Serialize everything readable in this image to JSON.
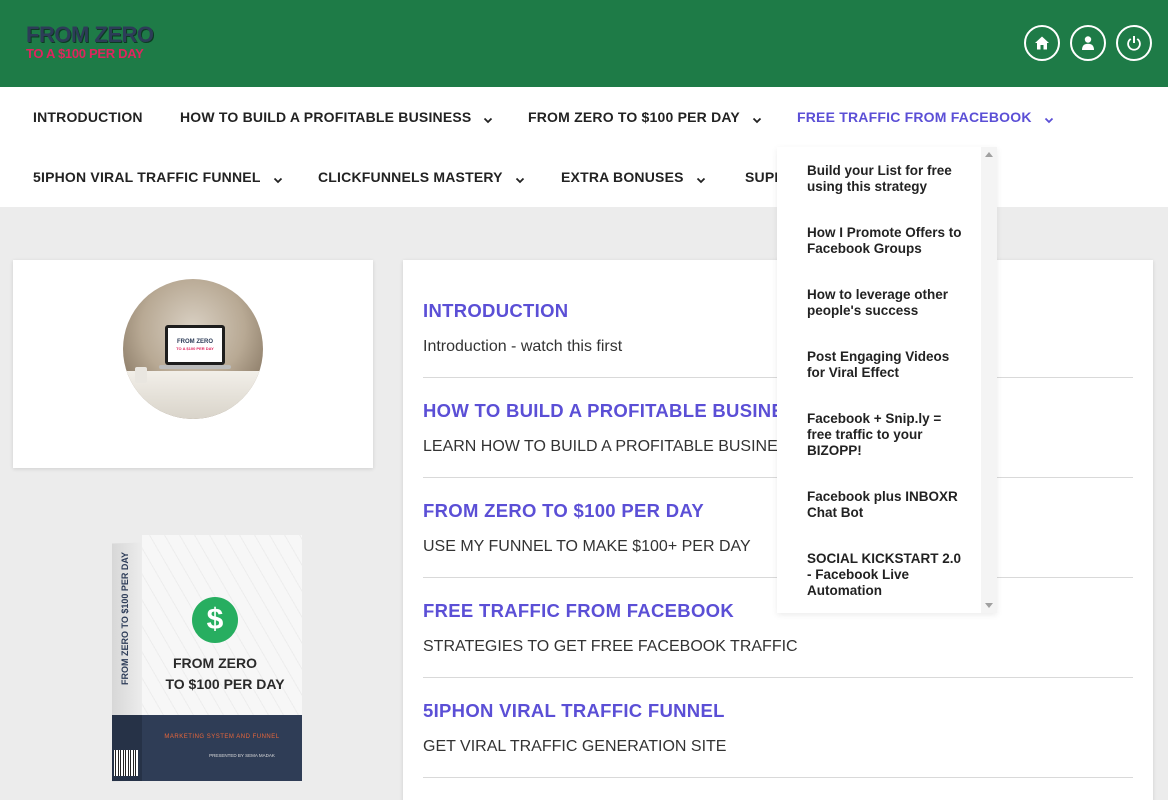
{
  "header": {
    "logo_line1": "FROM ZERO",
    "logo_line2": "TO A $100 PER DAY",
    "buttons": [
      "home-icon",
      "user-icon",
      "power-icon"
    ],
    "bg_color": "#1e7b47"
  },
  "nav": {
    "row1": [
      {
        "label": "INTRODUCTION",
        "dropdown": false
      },
      {
        "label": "HOW TO BUILD A PROFITABLE BUSINESS",
        "dropdown": true
      },
      {
        "label": "FROM ZERO TO $100 PER DAY",
        "dropdown": true
      },
      {
        "label": "FREE TRAFFIC FROM FACEBOOK",
        "dropdown": true,
        "active": true
      }
    ],
    "row2": [
      {
        "label": "5IPHON VIRAL TRAFFIC FUNNEL",
        "dropdown": true
      },
      {
        "label": "CLICKFUNNELS MASTERY",
        "dropdown": true
      },
      {
        "label": "EXTRA BONUSES",
        "dropdown": true
      },
      {
        "label": "SUPP",
        "dropdown": false
      }
    ],
    "active_color": "#5b4fd6"
  },
  "dropdown": {
    "items": [
      "Build your List for free using this strategy",
      "How I Promote Offers to Facebook Groups",
      "How to leverage other people's success",
      "Post Engaging Videos for Viral Effect",
      "Facebook + Snip.ly = free traffic to your BIZOPP!",
      "Facebook plus INBOXR Chat Bot",
      "SOCIAL KICKSTART 2.0 - Facebook Live Automation"
    ]
  },
  "avatar": {
    "screen_line1": "FROM ZERO",
    "screen_line2": "TO A $100 PER DAY"
  },
  "product_box": {
    "side_text": "FROM ZERO TO $100 PER DAY",
    "title_line1": "FROM ZERO",
    "title_line2": "TO $100 PER DAY",
    "subtitle": "MARKETING SYSTEM AND FUNNEL",
    "presented_by": "PRESENTED BY SEMA MADAK",
    "dollar": "$"
  },
  "lessons": [
    {
      "title": "INTRODUCTION",
      "desc": "Introduction - watch this first"
    },
    {
      "title": "HOW TO BUILD A PROFITABLE BUSINESS",
      "desc": "LEARN HOW TO BUILD A PROFITABLE BUSINESS"
    },
    {
      "title": "FROM ZERO TO $100 PER DAY",
      "desc": "USE MY FUNNEL TO MAKE $100+ PER DAY"
    },
    {
      "title": "FREE TRAFFIC FROM FACEBOOK",
      "desc": "STRATEGIES TO GET FREE FACEBOOK TRAFFIC"
    },
    {
      "title": "5IPHON VIRAL TRAFFIC FUNNEL",
      "desc": "GET VIRAL TRAFFIC GENERATION SITE"
    }
  ]
}
